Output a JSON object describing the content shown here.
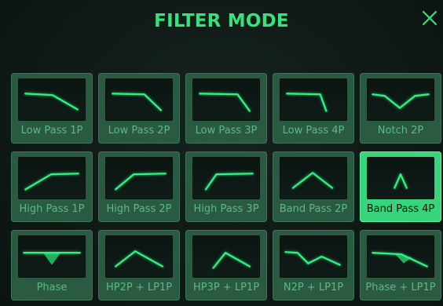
{
  "dialog": {
    "title": "FILTER MODE",
    "close_icon": "close-icon"
  },
  "accent_color": "#35e27e",
  "selected_mode": "Band Pass 4P",
  "modes": [
    {
      "label": "Low Pass 1P",
      "icon": "low-pass-1p-icon"
    },
    {
      "label": "Low Pass 2P",
      "icon": "low-pass-2p-icon"
    },
    {
      "label": "Low Pass 3P",
      "icon": "low-pass-3p-icon"
    },
    {
      "label": "Low Pass 4P",
      "icon": "low-pass-4p-icon"
    },
    {
      "label": "Notch 2P",
      "icon": "notch-2p-icon"
    },
    {
      "label": "High Pass 1P",
      "icon": "high-pass-1p-icon"
    },
    {
      "label": "High Pass 2P",
      "icon": "high-pass-2p-icon"
    },
    {
      "label": "High Pass 3P",
      "icon": "high-pass-3p-icon"
    },
    {
      "label": "Band Pass 2P",
      "icon": "band-pass-2p-icon"
    },
    {
      "label": "Band Pass 4P",
      "icon": "band-pass-4p-icon"
    },
    {
      "label": "Phase",
      "icon": "phase-icon"
    },
    {
      "label": "HP2P + LP1P",
      "icon": "hp2p-lp1p-icon"
    },
    {
      "label": "HP3P + LP1P",
      "icon": "hp3p-lp1p-icon"
    },
    {
      "label": "N2P + LP1P",
      "icon": "n2p-lp1p-icon"
    },
    {
      "label": "Phase + LP1P",
      "icon": "phase-lp1p-icon"
    }
  ]
}
